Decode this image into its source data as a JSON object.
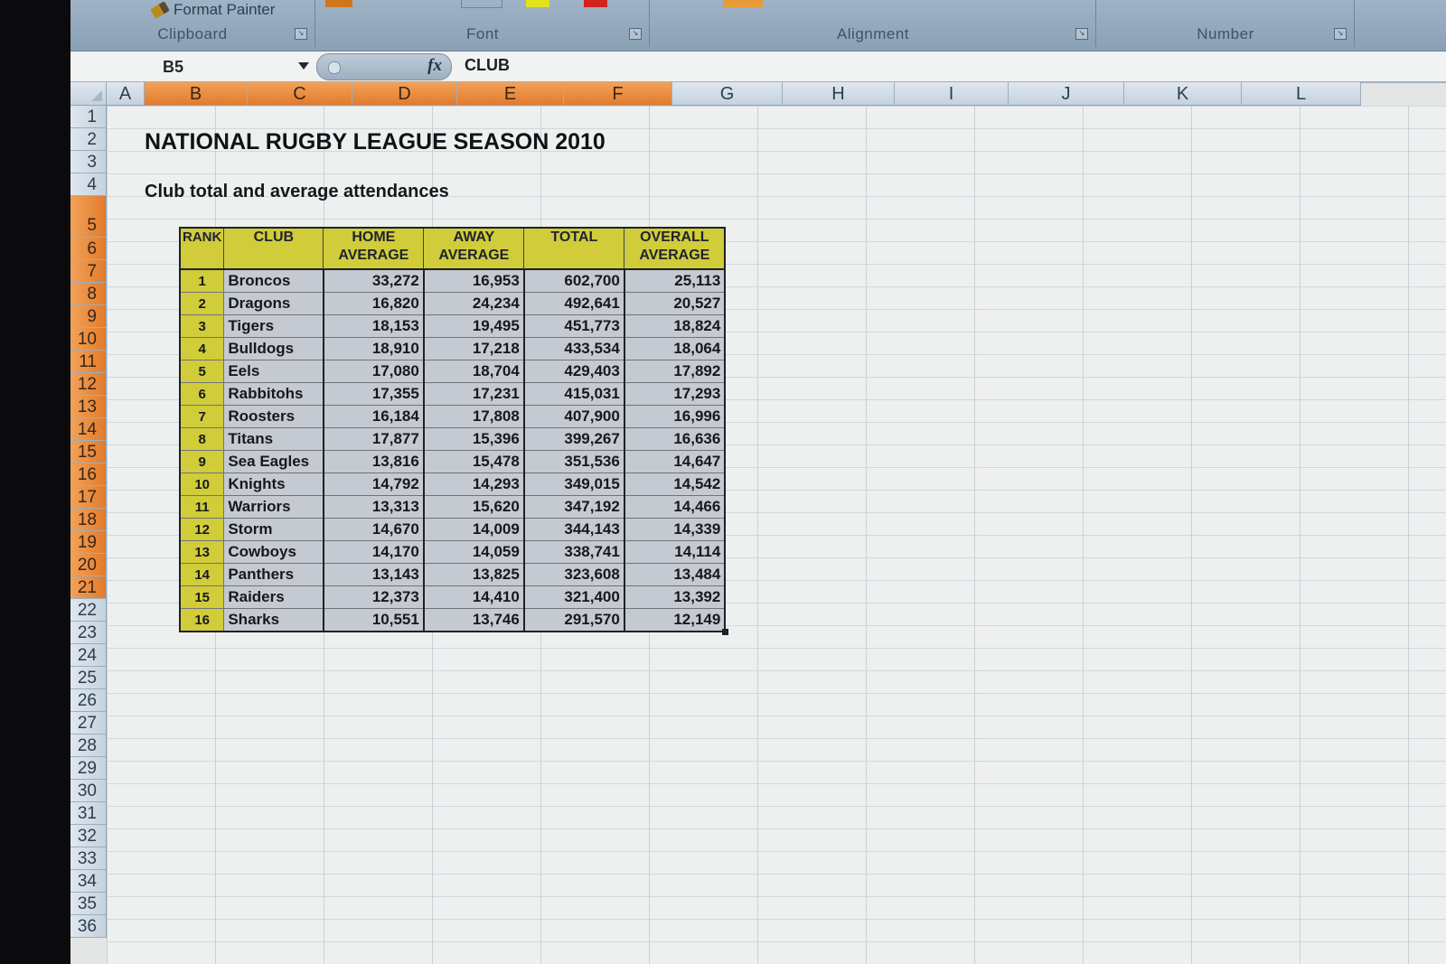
{
  "ribbon": {
    "format_painter": "Format Painter",
    "groups": {
      "clipboard": "Clipboard",
      "font": "Font",
      "alignment": "Alignment",
      "number": "Number"
    }
  },
  "formula_bar": {
    "name_box": "B5",
    "fx": "fx",
    "content": "CLUB"
  },
  "columns": [
    "A",
    "B",
    "C",
    "D",
    "E",
    "F",
    "G",
    "H",
    "I",
    "J",
    "K",
    "L"
  ],
  "rows": [
    "1",
    "2",
    "3",
    "4",
    "5",
    "6",
    "7",
    "8",
    "9",
    "10",
    "11",
    "12",
    "13",
    "14",
    "15",
    "16",
    "17",
    "18",
    "19",
    "20",
    "21",
    "22",
    "23",
    "24",
    "25",
    "26",
    "27",
    "28",
    "29",
    "30",
    "31",
    "32",
    "33",
    "34",
    "35",
    "36"
  ],
  "sheet": {
    "title": "NATIONAL RUGBY LEAGUE SEASON 2010",
    "subtitle": "Club total and average attendances",
    "headers": {
      "rank": "RANK",
      "club": "CLUB",
      "home_l1": "HOME",
      "home_l2": "AVERAGE",
      "away_l1": "AWAY",
      "away_l2": "AVERAGE",
      "total": "TOTAL",
      "overall_l1": "OVERALL",
      "overall_l2": "AVERAGE"
    },
    "table": [
      {
        "rank": "1",
        "club": "Broncos",
        "home": "33,272",
        "away": "16,953",
        "total": "602,700",
        "overall": "25,113"
      },
      {
        "rank": "2",
        "club": "Dragons",
        "home": "16,820",
        "away": "24,234",
        "total": "492,641",
        "overall": "20,527"
      },
      {
        "rank": "3",
        "club": "Tigers",
        "home": "18,153",
        "away": "19,495",
        "total": "451,773",
        "overall": "18,824"
      },
      {
        "rank": "4",
        "club": "Bulldogs",
        "home": "18,910",
        "away": "17,218",
        "total": "433,534",
        "overall": "18,064"
      },
      {
        "rank": "5",
        "club": "Eels",
        "home": "17,080",
        "away": "18,704",
        "total": "429,403",
        "overall": "17,892"
      },
      {
        "rank": "6",
        "club": "Rabbitohs",
        "home": "17,355",
        "away": "17,231",
        "total": "415,031",
        "overall": "17,293"
      },
      {
        "rank": "7",
        "club": "Roosters",
        "home": "16,184",
        "away": "17,808",
        "total": "407,900",
        "overall": "16,996"
      },
      {
        "rank": "8",
        "club": "Titans",
        "home": "17,877",
        "away": "15,396",
        "total": "399,267",
        "overall": "16,636"
      },
      {
        "rank": "9",
        "club": "Sea Eagles",
        "home": "13,816",
        "away": "15,478",
        "total": "351,536",
        "overall": "14,647"
      },
      {
        "rank": "10",
        "club": "Knights",
        "home": "14,792",
        "away": "14,293",
        "total": "349,015",
        "overall": "14,542"
      },
      {
        "rank": "11",
        "club": "Warriors",
        "home": "13,313",
        "away": "15,620",
        "total": "347,192",
        "overall": "14,466"
      },
      {
        "rank": "12",
        "club": "Storm",
        "home": "14,670",
        "away": "14,009",
        "total": "344,143",
        "overall": "14,339"
      },
      {
        "rank": "13",
        "club": "Cowboys",
        "home": "14,170",
        "away": "14,059",
        "total": "338,741",
        "overall": "14,114"
      },
      {
        "rank": "14",
        "club": "Panthers",
        "home": "13,143",
        "away": "13,825",
        "total": "323,608",
        "overall": "13,484"
      },
      {
        "rank": "15",
        "club": "Raiders",
        "home": "12,373",
        "away": "14,410",
        "total": "321,400",
        "overall": "13,392"
      },
      {
        "rank": "16",
        "club": "Sharks",
        "home": "10,551",
        "away": "13,746",
        "total": "291,570",
        "overall": "12,149"
      }
    ]
  },
  "colors": {
    "header_fill": "#d0cc3a",
    "selected_header": "#e17b2c",
    "data_fill": "#c5cad2"
  }
}
